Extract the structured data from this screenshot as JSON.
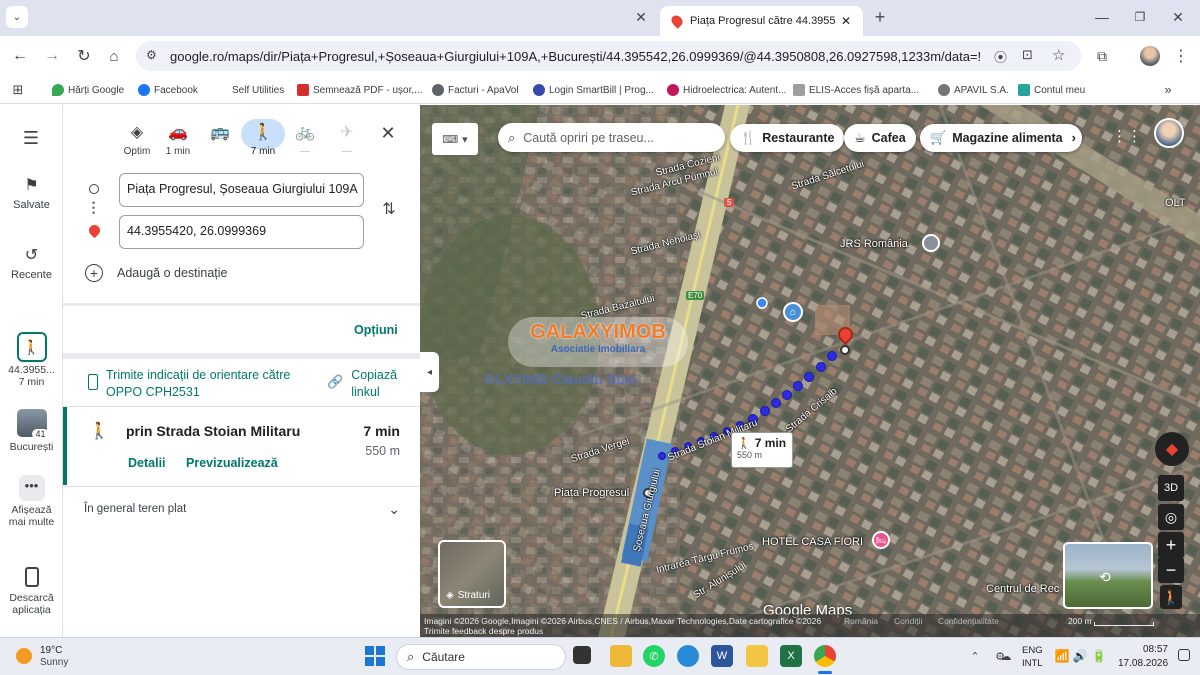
{
  "browser": {
    "active_tab_title": "Piața Progresul către 44.395542...",
    "url": "google.ro/maps/dir/Piața+Progresul,+Șoseaua+Giurgiului+109A,+București/44.395542,26.0999369/@44.3950808,26.0927598,1233m/data=!3m1!1e...",
    "bookmarks": [
      "Hărți Google",
      "Facebook",
      "Self Utilities",
      "Semnează PDF - ușor,...",
      "Facturi - ApaVol",
      "Login SmartBill | Prog...",
      "Hidroelectrica: Autent...",
      "ELIS-Acces fișă aparta...",
      "APAVIL S.A.",
      "Contul meu"
    ]
  },
  "rail": {
    "saved": "Salvate",
    "recent": "Recente",
    "route_item": {
      "title": "44.3955...",
      "time": "7 min"
    },
    "city_item": {
      "title": "București",
      "badge": "41"
    },
    "more": "Afișează mai multe",
    "download": "Descarcă aplicația"
  },
  "panel": {
    "modes": [
      {
        "label": "Optim",
        "icon": "diamond-turn-icon"
      },
      {
        "label": "1 min",
        "icon": "car-icon"
      },
      {
        "label": "",
        "icon": "bus-icon"
      },
      {
        "label": "7 min",
        "icon": "walk-icon"
      },
      {
        "label": "—",
        "icon": "bike-icon"
      },
      {
        "label": "—",
        "icon": "plane-icon"
      }
    ],
    "origin": "Piața Progresul, Șoseaua Giurgiului 109A",
    "destination": "44.3955420, 26.0999369",
    "add_destination": "Adaugă o destinație",
    "options": "Opțiuni",
    "send_directions": "Trimite indicații de orientare către OPPO CPH2531",
    "copy_link": "Copiază linkul",
    "route": {
      "title": "prin Strada Stoian Militaru",
      "time": "7 min",
      "distance": "550 m",
      "details": "Detalii",
      "preview": "Previzualizează"
    },
    "terrain": "În general teren plat"
  },
  "map": {
    "search_placeholder": "Caută opriri pe traseu...",
    "chips": [
      "Restaurante",
      "Cafea",
      "Magazine alimenta"
    ],
    "walk_box": {
      "time": "7 min",
      "distance": "550 m"
    },
    "watermark_top": "GALAXYIMOB",
    "watermark_sub": "Asociatie Imobiliara",
    "watermark_name": "GLXYIMB Claudiu Stan",
    "labels": {
      "jrs": "JRS România",
      "hotel": "HOTEL CASA FIORI",
      "piata": "Piața Progresul",
      "centrul": "Centrul de Rec",
      "cozieni": "Strada Cozieni",
      "arcpumnul": "Strada Arcu Pumnul",
      "salcetului": "Strada Sălcetului",
      "nehoiasi": "Strada Nehoiași",
      "bazaltului": "Strada Bazaltului",
      "stoian": "Strada Stoian Militaru",
      "cristalb": "Strada Crisalb",
      "vergei": "Strada Vergei",
      "giurgiului": "Șoseaua Giurgiului",
      "targu": "Intrarea Târgu Frumos",
      "alunisului": "Str. Alunișului",
      "e70": "E70",
      "five": "5",
      "oltenitei": "OLT"
    },
    "layers": "Straturi",
    "btn_3d": "3D",
    "attribution": "Imagini ©2026 Google,Imagini ©2026 Airbus,CNES / Airbus,Maxar Technologies,Date cartografice ©2026",
    "links": [
      "România",
      "Condiții",
      "Confidențialitate"
    ],
    "feedback": "Trimite feedback despre produs",
    "scale": "200 m",
    "logo": "Google Maps"
  },
  "taskbar": {
    "weather_temp": "19°C",
    "weather_desc": "Sunny",
    "search": "Căutare",
    "lang1": "ENG",
    "lang2": "INTL",
    "time": "08:57",
    "date": "17.08.2026"
  },
  "colors": {
    "accent": "#1a73e8",
    "teal": "#00796b",
    "route_dots": "#2d2be0",
    "pin": "#ea4335"
  }
}
